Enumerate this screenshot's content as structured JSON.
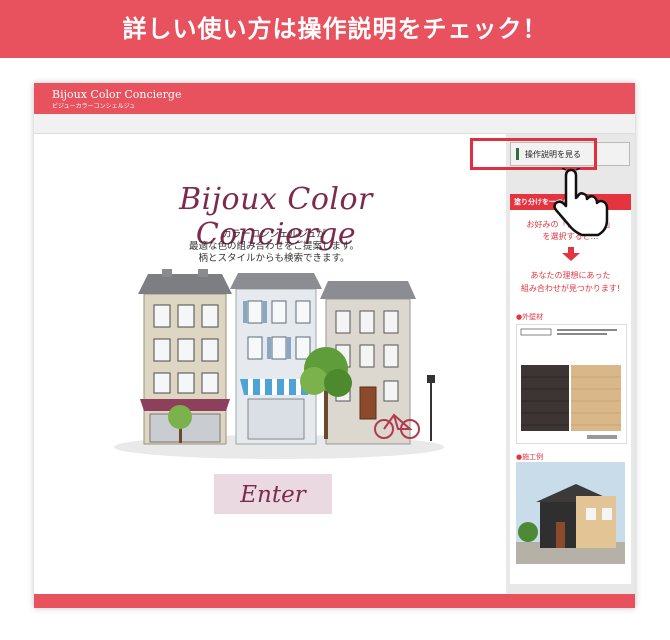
{
  "banner": {
    "text": "詳しい使い方は操作説明をチェック！"
  },
  "app": {
    "title": "Bijoux Color Concierge",
    "subtitle": "ビジューカラーコンシェルジュ"
  },
  "main": {
    "logo": "Bijoux Color Concierge",
    "tagline": [
      "カラーコンシェルジュが",
      "最適な色の組み合わせをご提案します。",
      "柄とスタイルからも検索できます。"
    ],
    "enter_label": "Enter"
  },
  "sidebar": {
    "help_button": "操作説明を見る",
    "promo_header": "塗り分けを一つのボタン",
    "promo_text1": "お好みの「色」と「…」",
    "promo_text1b": "を選択すると…",
    "promo_text2a": "あなたの理想にあった",
    "promo_text2b": "組み合わせが見つかります!",
    "label_exterior": "●外壁材",
    "label_example": "●施工例"
  },
  "colors": {
    "brand_red": "#e8525e",
    "logo_plum": "#7d2a4e",
    "enter_bg": "#ead9e0",
    "accent_red": "#e3343f"
  }
}
